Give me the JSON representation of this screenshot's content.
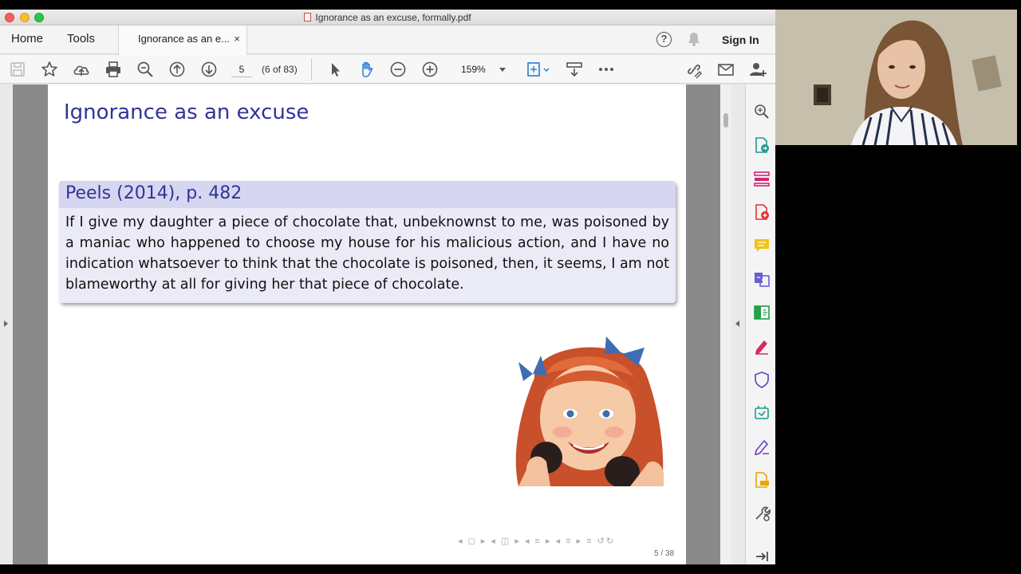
{
  "window": {
    "title": "Ignorance as an excuse, formally.pdf"
  },
  "menubar": {
    "home": "Home",
    "tools": "Tools",
    "doc_tab": "Ignorance as an e...",
    "doc_tab_close": "×",
    "help": "?",
    "sign_in": "Sign In"
  },
  "toolbar": {
    "page_number": "5",
    "page_count": "(6 of 83)",
    "zoom": "159%"
  },
  "slide": {
    "title": "Ignorance as an excuse",
    "block_title": "Peels (2014), p. 482",
    "block_body": "If I give my daughter a piece of chocolate that, unbeknownst to me, was poisoned by a maniac who happened to choose my house for his malicious action, and I have no indication whatsoever to think that the chocolate is poisoned, then, it seems, I am not blameworthy at all for giving her that piece of chocolate.",
    "nav_symbols": "◂ ◻ ▸ ◂ ◫ ▸ ◂ ≡ ▸ ◂ ≡ ▸ ≡ ↺↻",
    "slide_number": "5 / 38"
  },
  "icons": {
    "toolbar": [
      "save-icon",
      "bookmark-star-icon",
      "upload-cloud-icon",
      "print-icon",
      "zoom-out-search-icon",
      "page-up-icon",
      "page-down-icon",
      "select-arrow-icon",
      "hand-tool-icon",
      "zoom-minus-icon",
      "zoom-plus-icon",
      "fit-page-icon",
      "scroll-mode-icon",
      "more-icon",
      "link-icon",
      "mail-icon",
      "add-user-icon"
    ],
    "rail": [
      "search-zoom-icon",
      "export-pdf-icon",
      "organize-pages-icon",
      "create-pdf-icon",
      "comment-icon",
      "combine-files-icon",
      "compress-icon",
      "fill-sign-icon",
      "protect-shield-icon",
      "send-track-icon",
      "sign-icon",
      "scan-icon",
      "more-tools-icon",
      "collapse-panel-icon"
    ]
  },
  "colors": {
    "slide_title": "#333399",
    "block_header": "#d6d6f0",
    "block_body": "#ebebf7",
    "accent_blue": "#2a7ad6"
  }
}
